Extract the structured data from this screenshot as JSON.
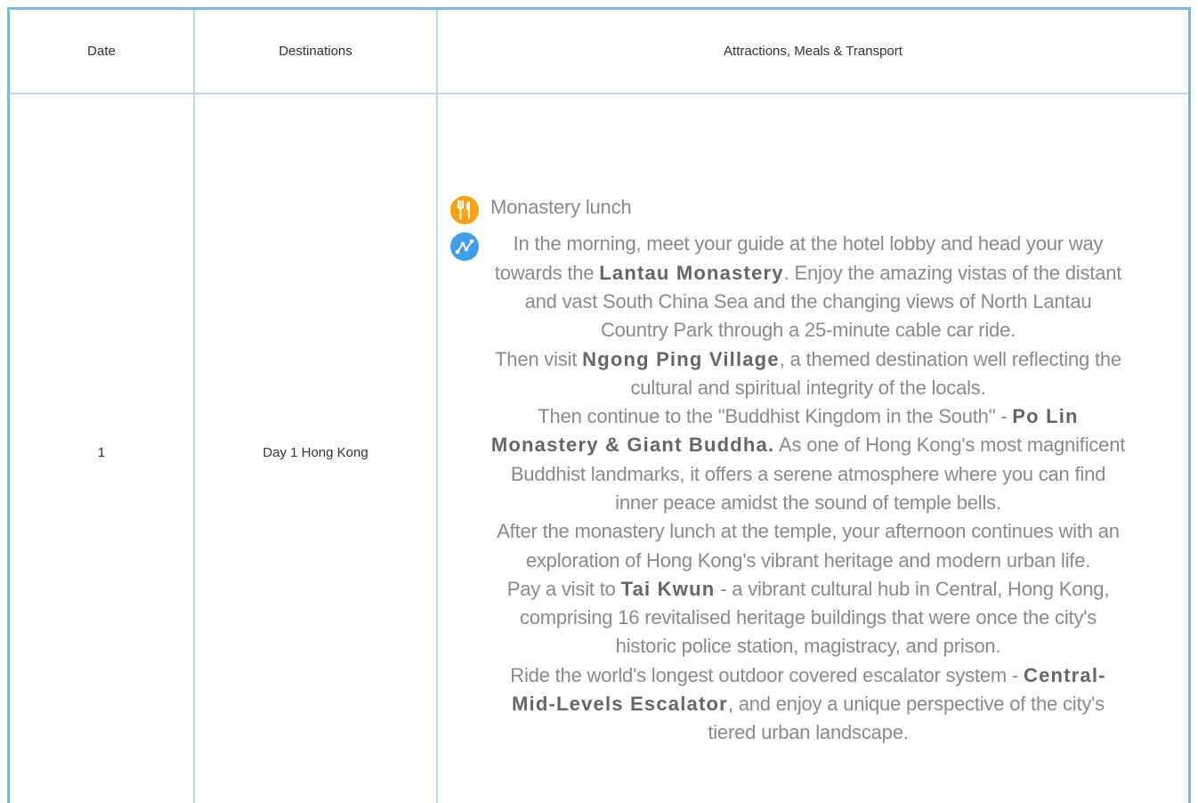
{
  "table": {
    "headers": {
      "date": "Date",
      "destinations": "Destinations",
      "details": "Attractions, Meals & Transport"
    },
    "row": {
      "date": "1",
      "destination": "Day 1 Hong Kong",
      "meal": "Monastery lunch",
      "itinerary": {
        "p1_a": "In the morning, meet your guide at the hotel lobby and head your way towards the ",
        "p1_b": "Lantau Monastery",
        "p1_c": ". Enjoy the amazing vistas of the distant and vast South China Sea and the changing views of North Lantau Country Park through a 25-minute cable car ride.",
        "p2_a": "Then visit ",
        "p2_b": "Ngong Ping Village",
        "p2_c": ", a themed destination well reflecting the cultural and spiritual integrity of the locals.",
        "p3_a": "Then continue to the \"Buddhist Kingdom in the South\" - ",
        "p3_b": "Po Lin Monastery & Giant Buddha.",
        "p3_c": " As one of Hong Kong's most magnificent Buddhist landmarks, it offers a serene atmosphere where you can find inner peace amidst the sound of temple bells.",
        "p4": "After the monastery lunch at the temple, your afternoon continues with an exploration of Hong Kong's vibrant heritage and modern urban life.",
        "p5_a": "Pay a visit to ",
        "p5_b": "Tai Kwun",
        "p5_c": " - a vibrant cultural hub in Central, Hong Kong, comprising 16 revitalised heritage buildings that were once the city's historic police station, magistracy, and prison.",
        "p6_a": "Ride the world's longest outdoor covered escalator system - ",
        "p6_b": "Central-Mid-Levels Escalator",
        "p6_c": ", and enjoy a unique perspective of the city's tiered urban landscape."
      }
    }
  },
  "icons": {
    "meal": "utensils-icon",
    "route": "route-icon"
  },
  "colors": {
    "border_outer": "#7ab8e6",
    "border_inner": "#bcd9f0",
    "meal_icon_bg": "#f6a313",
    "route_icon_bg": "#3f9ee9",
    "body_text": "#8a8a8a",
    "bold_text": "#666666"
  }
}
